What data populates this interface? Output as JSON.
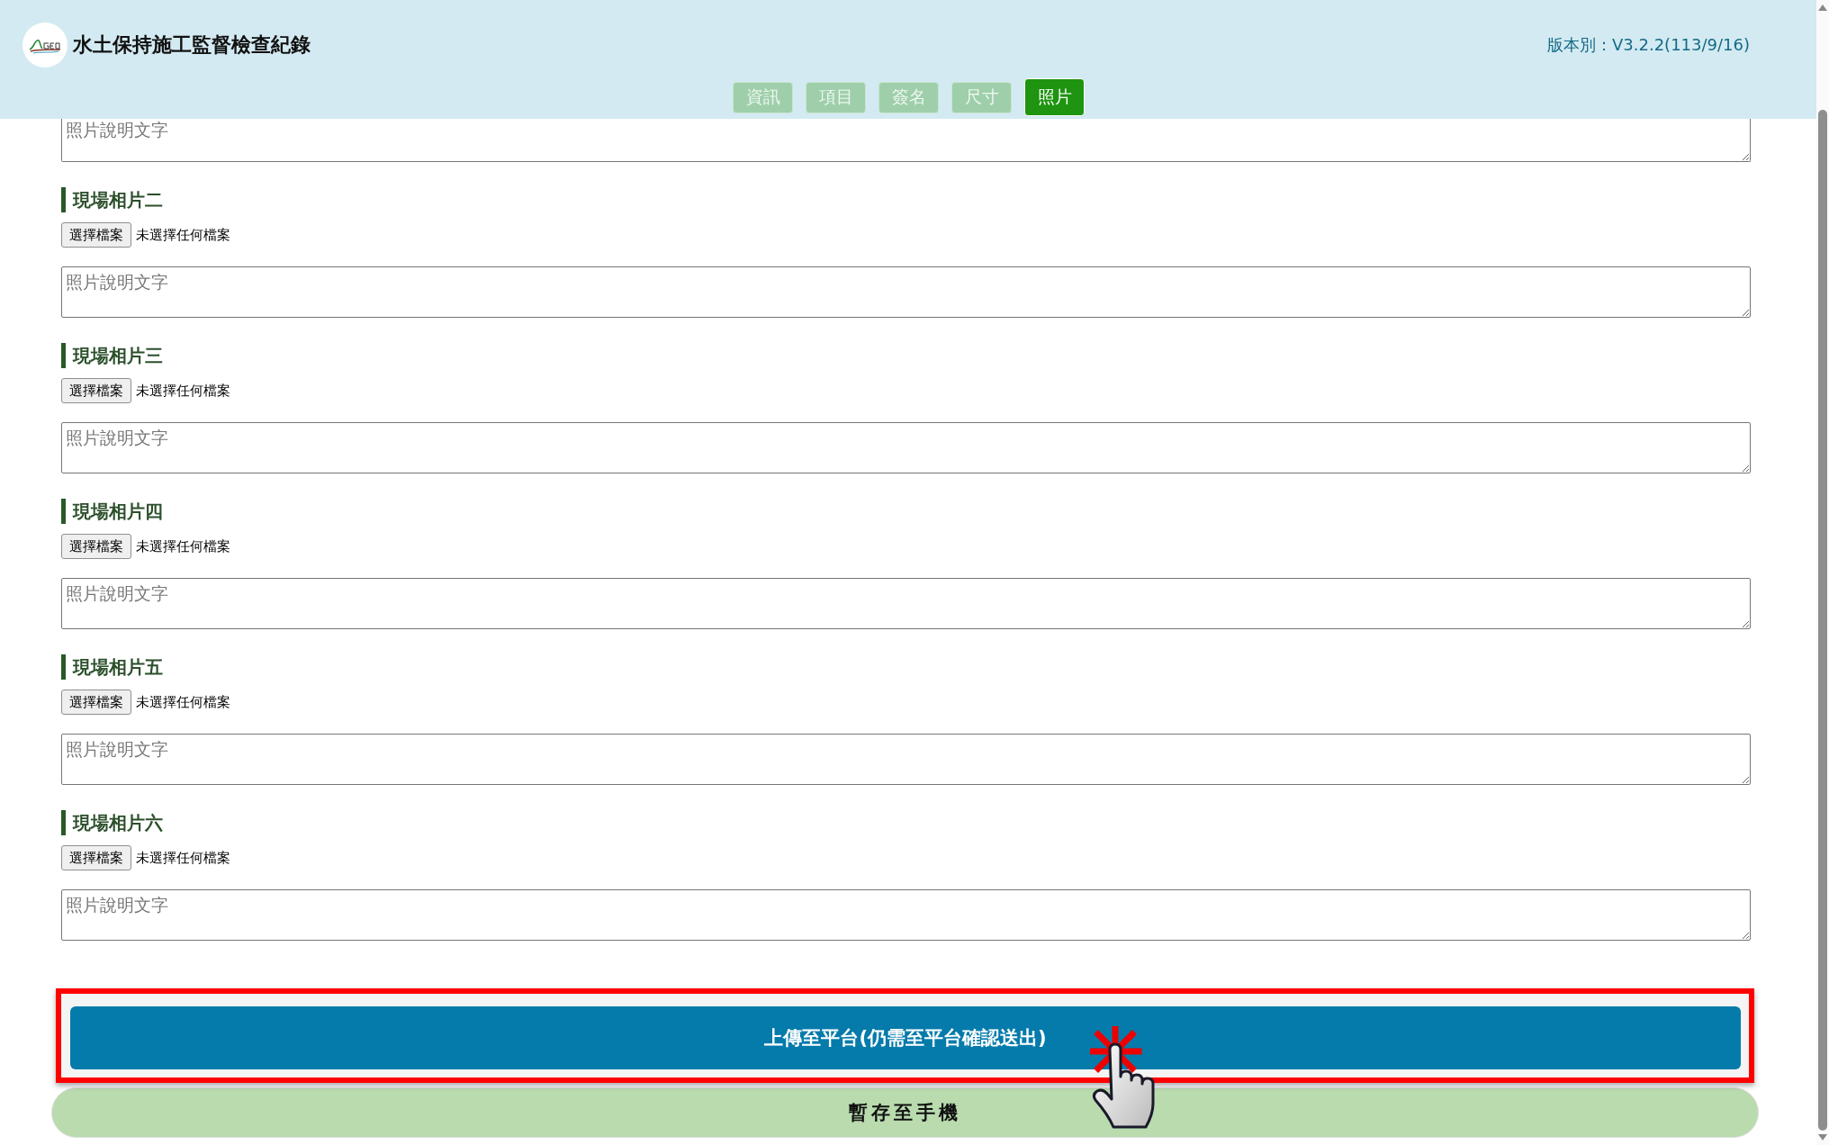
{
  "header": {
    "title": "水土保持施工監督檢查紀錄",
    "version": "版本別：V3.2.2(113/9/16)"
  },
  "tabs": [
    {
      "label": "資訊",
      "selected": false
    },
    {
      "label": "項目",
      "selected": false
    },
    {
      "label": "簽名",
      "selected": false
    },
    {
      "label": "尺寸",
      "selected": false
    },
    {
      "label": "照片",
      "selected": true
    }
  ],
  "top_caption": {
    "placeholder": "照片說明文字"
  },
  "sections": [
    {
      "title": "現場相片二",
      "file_button": "選擇檔案",
      "file_status": "未選擇任何檔案",
      "caption": {
        "placeholder": "照片說明文字"
      }
    },
    {
      "title": "現場相片三",
      "file_button": "選擇檔案",
      "file_status": "未選擇任何檔案",
      "caption": {
        "placeholder": "照片說明文字"
      }
    },
    {
      "title": "現場相片四",
      "file_button": "選擇檔案",
      "file_status": "未選擇任何檔案",
      "caption": {
        "placeholder": "照片說明文字"
      }
    },
    {
      "title": "現場相片五",
      "file_button": "選擇檔案",
      "file_status": "未選擇任何檔案",
      "caption": {
        "placeholder": "照片說明文字"
      }
    },
    {
      "title": "現場相片六",
      "file_button": "選擇檔案",
      "file_status": "未選擇任何檔案",
      "caption": {
        "placeholder": "照片說明文字"
      }
    }
  ],
  "buttons": [
    {
      "kind": "upload",
      "label": "上傳至平台(仍需至平台確認送出)",
      "highlighted": true
    },
    {
      "kind": "save",
      "label": "暫存至手機",
      "highlighted": false
    }
  ]
}
